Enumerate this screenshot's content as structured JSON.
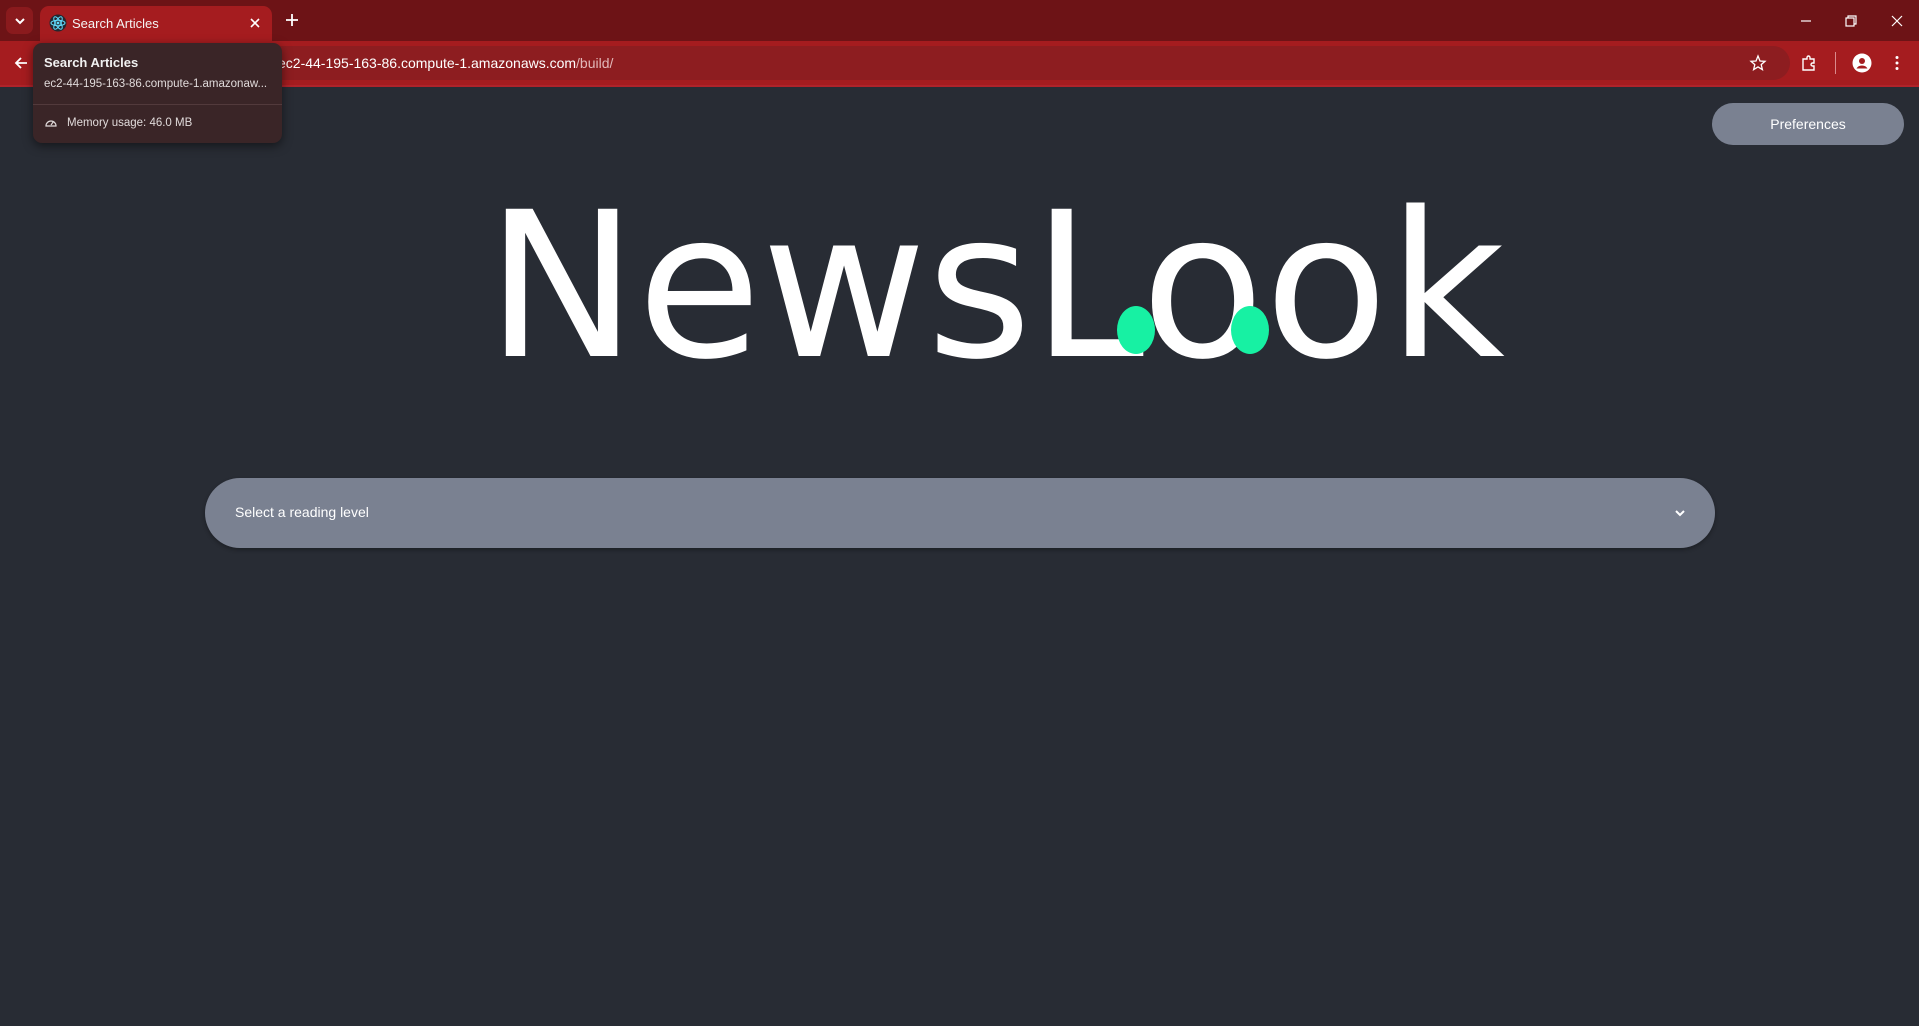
{
  "browser": {
    "tab": {
      "title": "Search Articles"
    },
    "address_bar": {
      "url_host": "ec2-44-195-163-86.compute-1.amazonaws.com",
      "url_path": "/build/"
    },
    "hover_card": {
      "title": "Search Articles",
      "url": "ec2-44-195-163-86.compute-1.amazonaw...",
      "memory": "Memory usage: 46.0 MB"
    }
  },
  "page": {
    "preferences_label": "Preferences",
    "logo_text": "NewsLook",
    "reading_level_placeholder": "Select a reading level"
  },
  "colors": {
    "page_bg": "#282c34",
    "tabstrip": "#6d1316",
    "toolbar": "#a51c1f",
    "control_bg": "#7a8191",
    "logo_accent": "#17f1a3"
  },
  "icons": {
    "tab_search": "chevron-down-icon",
    "favicon": "react-icon",
    "tab_close": "close-icon",
    "new_tab": "plus-icon",
    "minimize": "minimize-icon",
    "restore": "restore-icon",
    "close_window": "close-icon",
    "back": "arrow-left-icon",
    "bookmark": "star-icon",
    "extensions": "puzzle-icon",
    "profile": "person-icon",
    "menu": "kebab-menu-icon",
    "memory": "gauge-icon",
    "select": "chevron-down-icon"
  }
}
